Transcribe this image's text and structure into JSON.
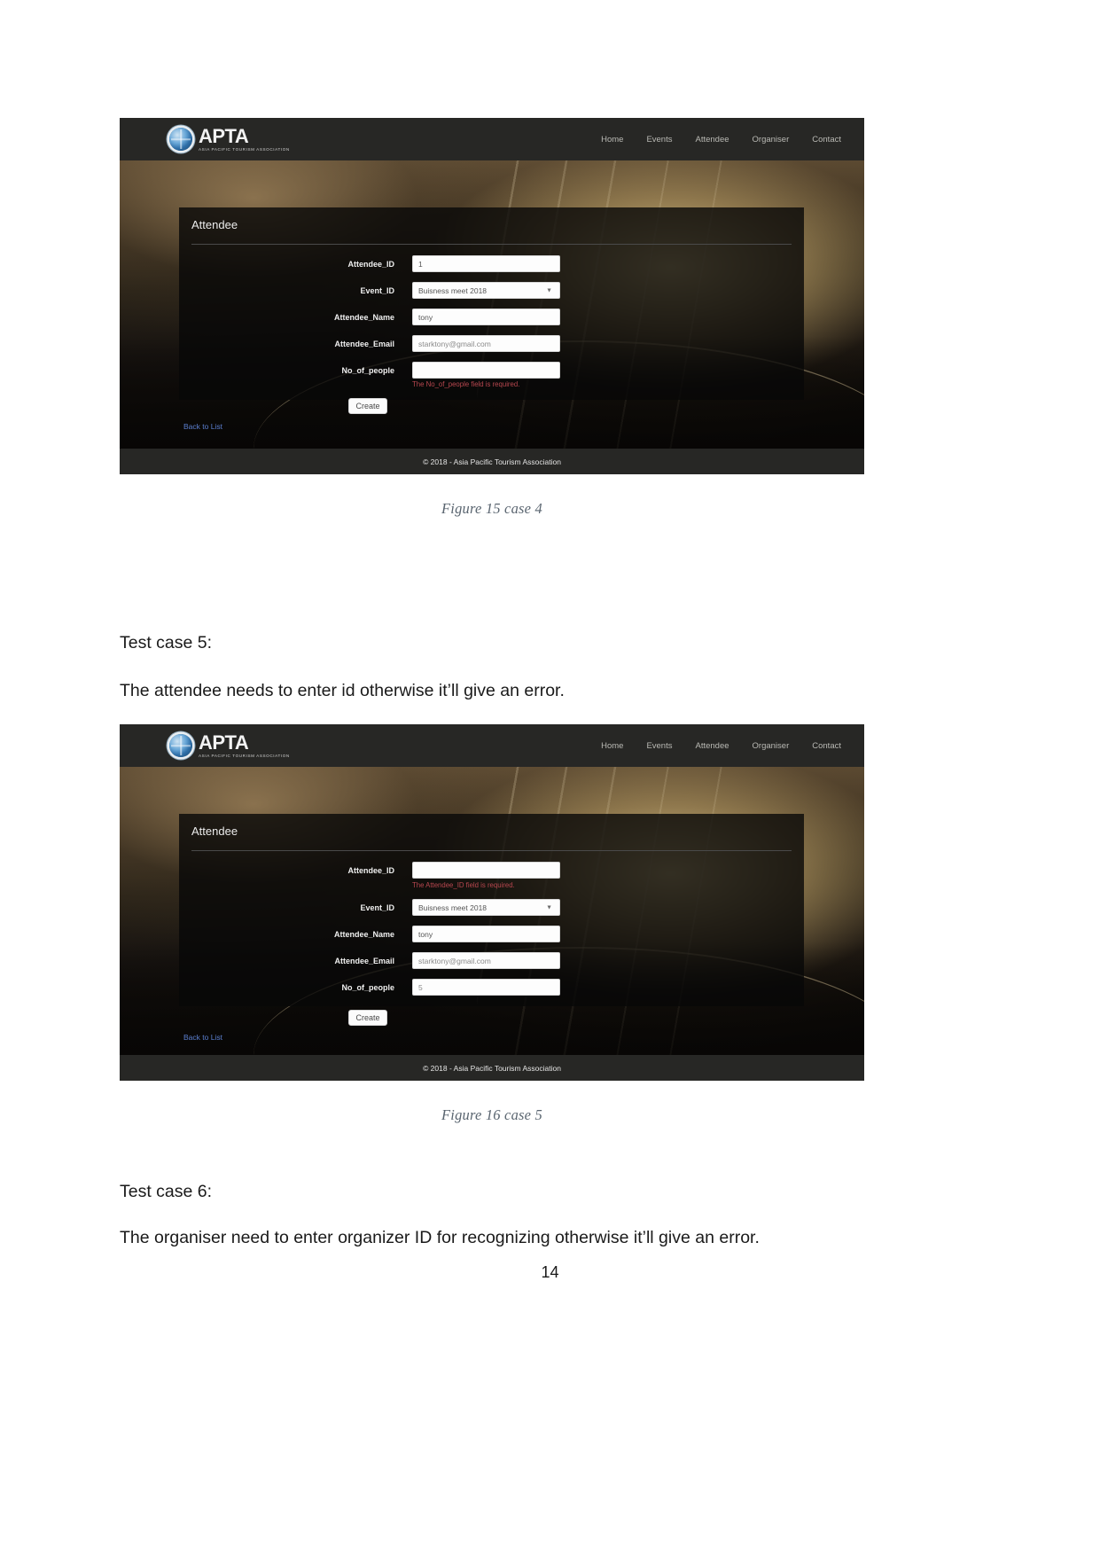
{
  "document": {
    "page_number": "14",
    "sections": [
      {
        "heading": "Test case 5:",
        "body": "The attendee needs to enter id otherwise it’ll give an error."
      },
      {
        "heading": "Test case 6:",
        "body": "The organiser need to enter organizer ID for recognizing otherwise it’ll give an error."
      }
    ],
    "captions": {
      "figure15": "Figure 15 case 4",
      "figure16": "Figure 16 case 5"
    }
  },
  "screenshot_common": {
    "brand": {
      "name": "APTA",
      "tagline": "ASIA PACIFIC TOURISM ASSOCIATION",
      "logo_icon": "globe-icon"
    },
    "nav": [
      {
        "label": "Home"
      },
      {
        "label": "Events"
      },
      {
        "label": "Attendee"
      },
      {
        "label": "Organiser"
      },
      {
        "label": "Contact"
      }
    ],
    "panel_title": "Attendee",
    "create_button": "Create",
    "back_link": "Back to List",
    "footer": "© 2018 - Asia Pacific Tourism Association",
    "colors": {
      "navbar": "#272725",
      "error_text": "#b8474f",
      "link": "#5b7fcf",
      "panel": "rgba(8,8,8,.80)"
    }
  },
  "figure15": {
    "fields": [
      {
        "label": "Attendee_ID",
        "value": "1",
        "type": "text"
      },
      {
        "label": "Event_ID",
        "value": "Buisness meet 2018",
        "type": "select"
      },
      {
        "label": "Attendee_Name",
        "value": "tony",
        "type": "text"
      },
      {
        "label": "Attendee_Email",
        "value": "starktony@gmail.com",
        "type": "text"
      },
      {
        "label": "No_of_people",
        "value": "",
        "type": "text"
      }
    ],
    "error": "The No_of_people field is required."
  },
  "figure16": {
    "fields": [
      {
        "label": "Attendee_ID",
        "value": "",
        "type": "text"
      },
      {
        "label": "Event_ID",
        "value": "Buisness meet 2018",
        "type": "select"
      },
      {
        "label": "Attendee_Name",
        "value": "tony",
        "type": "text"
      },
      {
        "label": "Attendee_Email",
        "value": "starktony@gmail.com",
        "type": "text"
      },
      {
        "label": "No_of_people",
        "value": "5",
        "type": "text"
      }
    ],
    "error": "The Attendee_ID field is required."
  }
}
